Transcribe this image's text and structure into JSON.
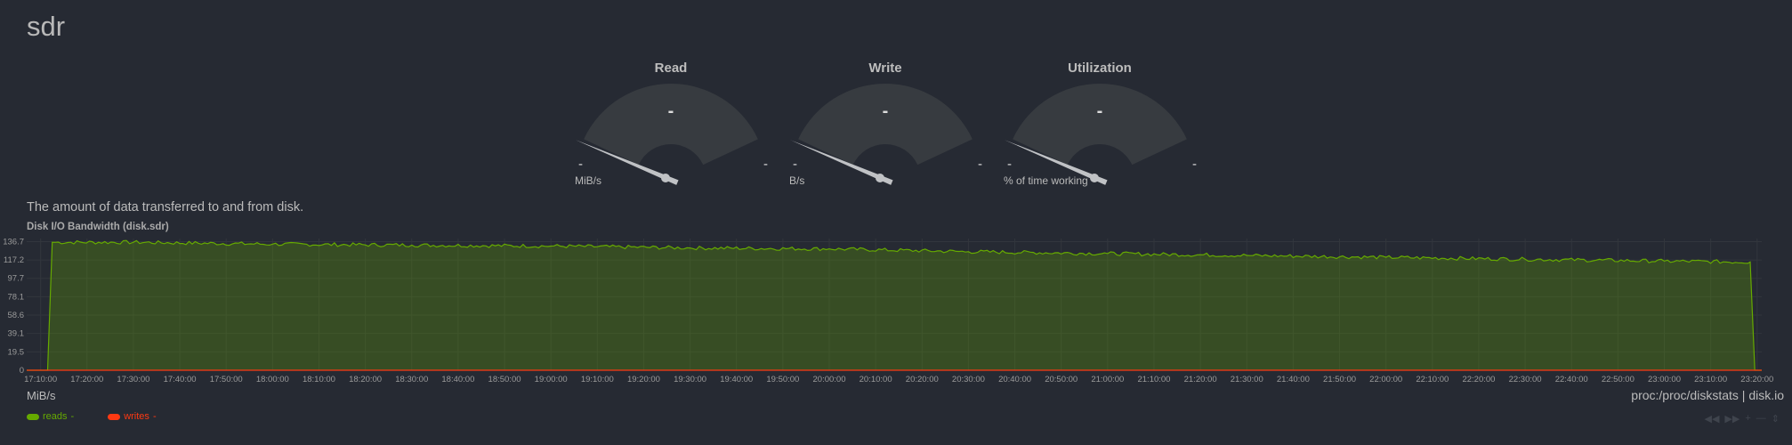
{
  "page": {
    "title": "sdr",
    "description": "The amount of data transferred to and from disk.",
    "chart_title": "Disk I/O Bandwidth (disk.sdr)",
    "units": "MiB/s",
    "source": "proc:/proc/diskstats | disk.io"
  },
  "gauges": [
    {
      "title": "Read",
      "value": "-",
      "min": "-",
      "max": "-",
      "units": "MiB/s"
    },
    {
      "title": "Write",
      "value": "-",
      "min": "-",
      "max": "-",
      "units": "B/s"
    },
    {
      "title": "Utilization",
      "value": "-",
      "min": "-",
      "max": "-",
      "units": "% of time working"
    }
  ],
  "legend": [
    {
      "name": "reads",
      "value": "-",
      "color": "#66aa00"
    },
    {
      "name": "writes",
      "value": "-",
      "color": "#fe3912"
    }
  ],
  "toolbox": [
    "left-icon",
    "right-icon",
    "zoom-in-icon",
    "zoom-out-icon",
    "resize-icon"
  ],
  "chart_data": {
    "type": "area",
    "title": "Disk I/O Bandwidth (disk.sdr)",
    "ylabel": "MiB/s",
    "y_ticks": [
      "0",
      "19.5",
      "39.1",
      "58.6",
      "78.1",
      "97.7",
      "117.2",
      "136.7"
    ],
    "ylim": [
      0,
      140
    ],
    "x_ticks": [
      "17:10:00",
      "17:20:00",
      "17:30:00",
      "17:40:00",
      "17:50:00",
      "18:00:00",
      "18:10:00",
      "18:20:00",
      "18:30:00",
      "18:40:00",
      "18:50:00",
      "19:00:00",
      "19:10:00",
      "19:20:00",
      "19:30:00",
      "19:40:00",
      "19:50:00",
      "20:00:00",
      "20:10:00",
      "20:20:00",
      "20:30:00",
      "20:40:00",
      "20:50:00",
      "21:00:00",
      "21:10:00",
      "21:20:00",
      "21:30:00",
      "21:40:00",
      "21:50:00",
      "22:00:00",
      "22:10:00",
      "22:20:00",
      "22:30:00",
      "22:40:00",
      "22:50:00",
      "23:00:00",
      "23:10:00",
      "23:20:00"
    ],
    "x_range": [
      "17:07:00",
      "23:21:00"
    ],
    "grid": true,
    "series": [
      {
        "name": "reads",
        "color": "#66aa00",
        "points": [
          [
            "17:07:00",
            0
          ],
          [
            "17:11:30",
            0
          ],
          [
            "17:12:30",
            136
          ],
          [
            "17:30:00",
            136
          ],
          [
            "18:00:00",
            134
          ],
          [
            "18:30:00",
            133
          ],
          [
            "19:00:00",
            132
          ],
          [
            "19:30:00",
            130
          ],
          [
            "20:00:00",
            129
          ],
          [
            "20:30:00",
            126
          ],
          [
            "21:00:00",
            124
          ],
          [
            "21:30:00",
            122
          ],
          [
            "22:00:00",
            120
          ],
          [
            "22:30:00",
            118
          ],
          [
            "23:00:00",
            116
          ],
          [
            "23:18:30",
            115
          ],
          [
            "23:19:30",
            0
          ],
          [
            "23:21:00",
            0
          ]
        ]
      },
      {
        "name": "writes",
        "color": "#fe3912",
        "points": [
          [
            "17:07:00",
            0
          ],
          [
            "23:21:00",
            0
          ]
        ]
      }
    ]
  }
}
